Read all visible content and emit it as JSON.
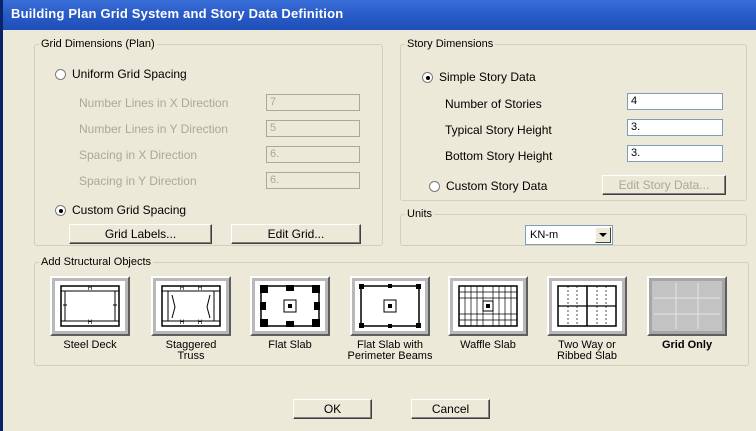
{
  "window": {
    "title": "Building Plan Grid System and Story Data Definition"
  },
  "grid_dimensions": {
    "legend": "Grid Dimensions (Plan)",
    "uniform_label": "Uniform Grid Spacing",
    "fields": [
      {
        "label": "Number Lines in X Direction",
        "value": "7"
      },
      {
        "label": "Number Lines in Y Direction",
        "value": "5"
      },
      {
        "label": "Spacing in X Direction",
        "value": "6."
      },
      {
        "label": "Spacing in Y Direction",
        "value": "6."
      }
    ],
    "custom_label": "Custom Grid Spacing",
    "grid_labels_button": "Grid Labels...",
    "edit_grid_button": "Edit Grid..."
  },
  "story_dimensions": {
    "legend": "Story Dimensions",
    "simple_label": "Simple Story Data",
    "fields": [
      {
        "label": "Number of Stories",
        "value": "4"
      },
      {
        "label": "Typical Story Height",
        "value": "3."
      },
      {
        "label": "Bottom Story Height",
        "value": "3."
      }
    ],
    "custom_label": "Custom Story Data",
    "edit_story_button": "Edit Story Data..."
  },
  "units": {
    "legend": "Units",
    "value": "KN-m"
  },
  "structural_objects": {
    "legend": "Add Structural Objects",
    "items": [
      {
        "label": "Steel Deck",
        "icon": "steel-deck-icon"
      },
      {
        "label": "Staggered\nTruss",
        "icon": "staggered-truss-icon"
      },
      {
        "label": "Flat Slab",
        "icon": "flat-slab-icon"
      },
      {
        "label": "Flat Slab with\nPerimeter Beams",
        "icon": "flat-slab-perimeter-beams-icon"
      },
      {
        "label": "Waffle Slab",
        "icon": "waffle-slab-icon"
      },
      {
        "label": "Two Way or\nRibbed Slab",
        "icon": "two-way-ribbed-slab-icon"
      },
      {
        "label": "Grid Only",
        "icon": "grid-only-icon"
      }
    ]
  },
  "buttons": {
    "ok": "OK",
    "cancel": "Cancel"
  }
}
